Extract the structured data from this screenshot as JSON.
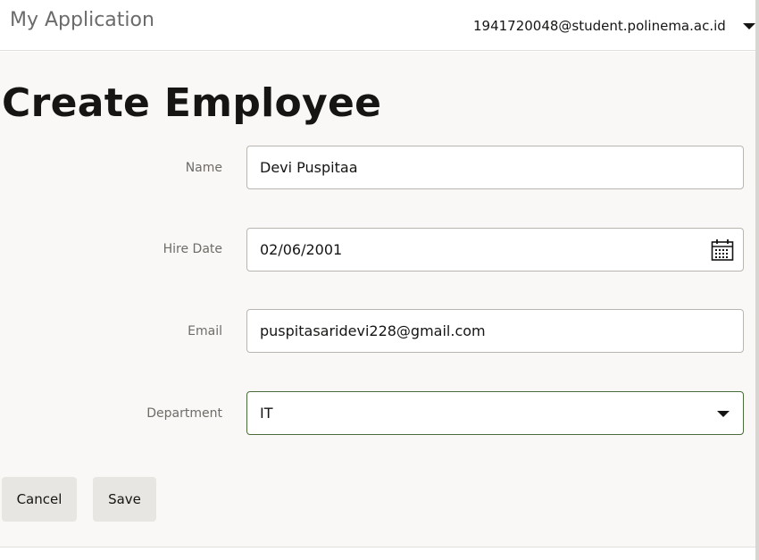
{
  "header": {
    "app_title": "My Application",
    "user_email": "1941720048@student.polinema.ac.id"
  },
  "page": {
    "title": "Create Employee"
  },
  "form": {
    "name": {
      "label": "Name",
      "value": "Devi Puspitaa"
    },
    "hire_date": {
      "label": "Hire Date",
      "value": "02/06/2001"
    },
    "email": {
      "label": "Email",
      "value": "puspitasaridevi228@gmail.com"
    },
    "department": {
      "label": "Department",
      "value": "IT"
    }
  },
  "actions": {
    "cancel_label": "Cancel",
    "save_label": "Save"
  },
  "icons": {
    "calendar": "calendar-icon",
    "dropdown": "chevron-down-icon"
  },
  "colors": {
    "background": "#f9f8f6",
    "header_background": "#ffffff",
    "button_background": "#e8e6e3",
    "select_border": "#4a6b3a"
  }
}
